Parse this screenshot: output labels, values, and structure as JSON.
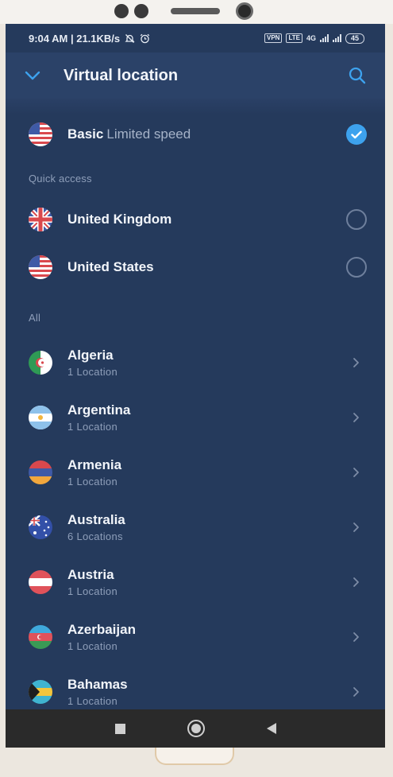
{
  "status_bar": {
    "time_speed": "9:04 AM | 21.1KB/s",
    "vpn_badge": "VPN",
    "lte_badge": "LTE",
    "net_type": "4G",
    "battery": "45"
  },
  "header": {
    "title": "Virtual location"
  },
  "basic": {
    "name": "Basic",
    "subtitle": "Limited speed"
  },
  "quick_access": {
    "label": "Quick access",
    "items": [
      {
        "name": "United Kingdom",
        "flag": "uk-flag-icon"
      },
      {
        "name": "United States",
        "flag": "us-flag-icon"
      }
    ]
  },
  "all": {
    "label": "All",
    "items": [
      {
        "name": "Algeria",
        "sub": "1 Location"
      },
      {
        "name": "Argentina",
        "sub": "1 Location"
      },
      {
        "name": "Armenia",
        "sub": "1 Location"
      },
      {
        "name": "Australia",
        "sub": "6 Locations"
      },
      {
        "name": "Austria",
        "sub": "1 Location"
      },
      {
        "name": "Azerbaijan",
        "sub": "1 Location"
      },
      {
        "name": "Bahamas",
        "sub": "1 Location"
      }
    ]
  },
  "colors": {
    "background": "#253a5c",
    "header": "#2b4268",
    "accent": "#3da2ee",
    "nav_bar": "#2a2a2a"
  }
}
